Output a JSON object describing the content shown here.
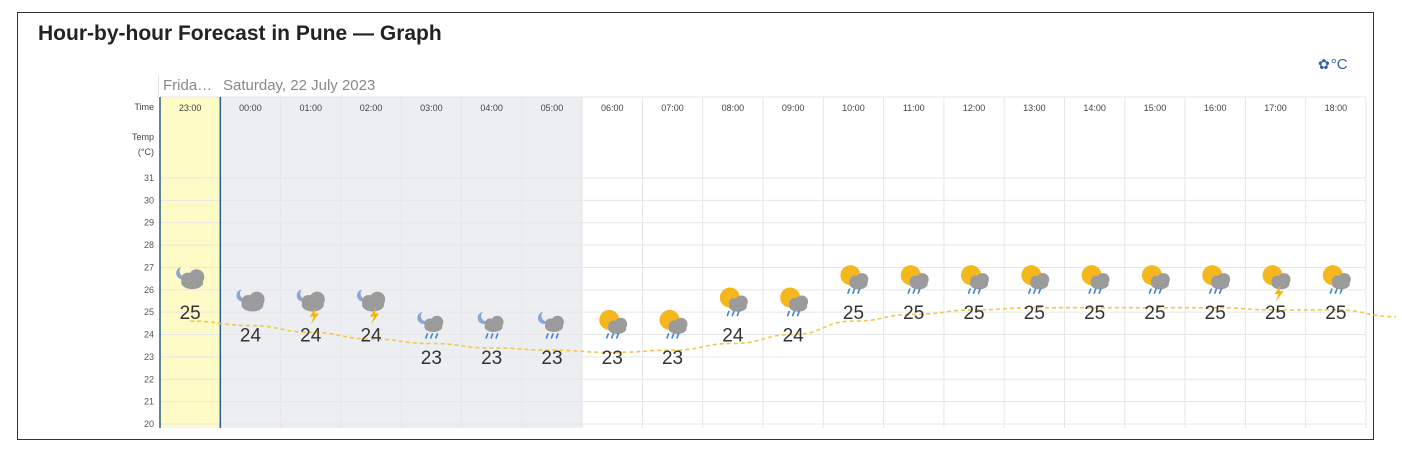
{
  "page": {
    "title": "Hour-by-hour Forecast in Pune — Graph",
    "units_label": "°C",
    "day_labels": {
      "friday": "Frida…",
      "saturday": "Saturday, 22 July 2023"
    }
  },
  "chart_data": {
    "type": "line",
    "row_labels": {
      "time": "Time",
      "temp_line1": "Temp",
      "temp_line2": "(°C)"
    },
    "x": [
      "23:00",
      "00:00",
      "01:00",
      "02:00",
      "03:00",
      "04:00",
      "05:00",
      "06:00",
      "07:00",
      "08:00",
      "09:00",
      "10:00",
      "11:00",
      "12:00",
      "13:00",
      "14:00",
      "15:00",
      "16:00",
      "17:00",
      "18:00"
    ],
    "temperature_labels": [
      25,
      24,
      24,
      24,
      23,
      23,
      23,
      23,
      23,
      24,
      24,
      25,
      25,
      25,
      25,
      25,
      25,
      25,
      25,
      25
    ],
    "trend_line": [
      24.6,
      24.4,
      24.1,
      23.8,
      23.6,
      23.4,
      23.3,
      23.2,
      23.3,
      23.6,
      24.0,
      24.6,
      24.9,
      25.1,
      25.2,
      25.2,
      25.2,
      25.2,
      25.1,
      25.1,
      24.8
    ],
    "icons": [
      "night-cloudy-icon",
      "night-cloudy-icon",
      "night-thunderstorm-icon",
      "night-thunderstorm-icon",
      "night-rain-icon",
      "night-rain-icon",
      "night-rain-icon",
      "day-rain-icon",
      "day-rain-icon",
      "day-rain-icon",
      "day-rain-icon",
      "day-rain-icon",
      "day-rain-icon",
      "day-rain-icon",
      "day-rain-icon",
      "day-rain-icon",
      "day-rain-icon",
      "day-rain-icon",
      "day-thunderstorm-icon",
      "day-rain-icon"
    ],
    "ylim": [
      20,
      31
    ],
    "yticks": [
      20,
      21,
      22,
      23,
      24,
      25,
      26,
      27,
      28,
      29,
      30,
      31
    ],
    "current_hour": "23:00",
    "night_hours": [
      "00:00",
      "01:00",
      "02:00",
      "03:00",
      "04:00",
      "05:00"
    ],
    "grid": true,
    "colors": {
      "current_highlight": "#fffbc7",
      "night_shade": "#eceef1",
      "line": "#f5c64a",
      "temp_text": "#333333",
      "grid": "#e6e6e6",
      "divider": "#2c5d86",
      "sun": "#f4b71d",
      "cloud": "#9b9b9b",
      "moon": "#8aa6d6",
      "rain": "#3f84d6",
      "bolt": "#f2b705"
    }
  }
}
